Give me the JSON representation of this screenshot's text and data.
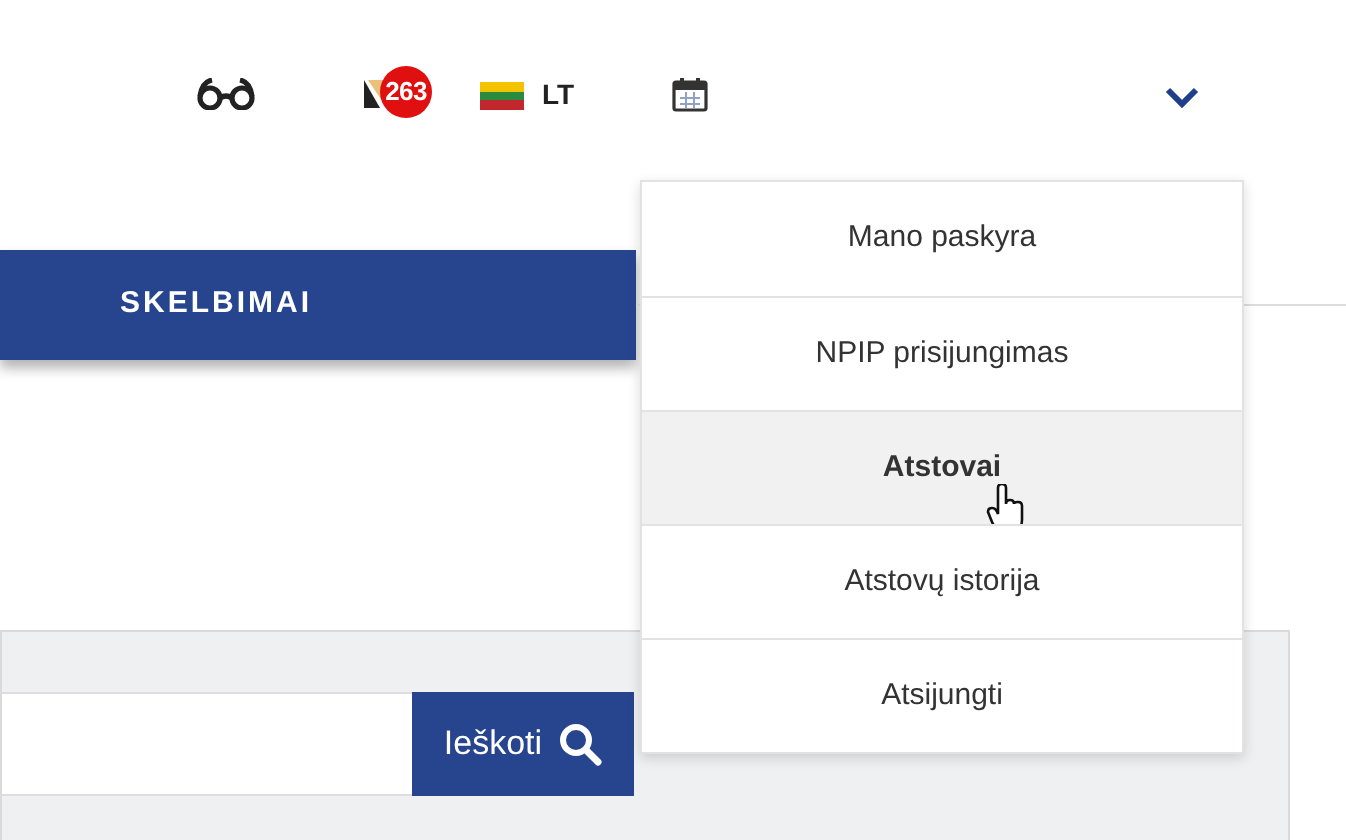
{
  "header": {
    "notifications": {
      "count": "263"
    },
    "language": {
      "code": "LT"
    }
  },
  "nav": {
    "items": [
      {
        "label": "SKELBIMAI"
      }
    ]
  },
  "search": {
    "button": "Ieškoti"
  },
  "account_menu": {
    "expanded": true,
    "items": [
      {
        "label": "Mano paskyra",
        "selected": false
      },
      {
        "label": "NPIP prisijungimas",
        "selected": false
      },
      {
        "label": "Atstovai",
        "selected": true
      },
      {
        "label": "Atstovų istorija",
        "selected": false
      },
      {
        "label": "Atsijungti",
        "selected": false
      }
    ]
  }
}
